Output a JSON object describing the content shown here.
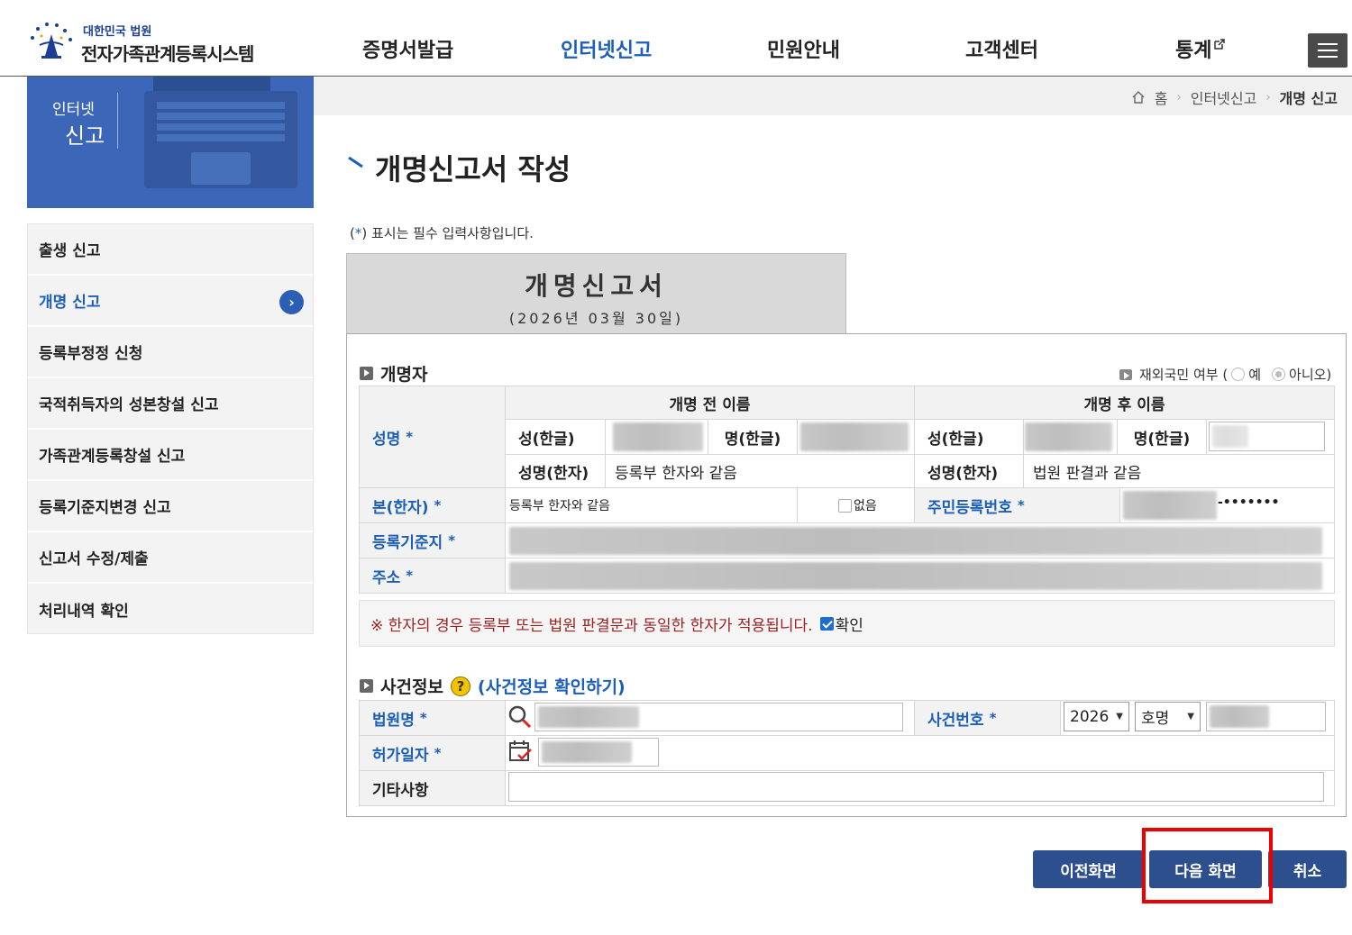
{
  "header": {
    "logo_sub": "대한민국 법원",
    "logo_main": "전자가족관계등록시스템",
    "nav": [
      {
        "label": "증명서발급",
        "active": false
      },
      {
        "label": "인터넷신고",
        "active": true
      },
      {
        "label": "민원안내",
        "active": false
      },
      {
        "label": "고객센터",
        "active": false
      },
      {
        "label": "통계",
        "active": false
      }
    ],
    "menu_icon": "hamburger-icon"
  },
  "banner": {
    "line1": "인터넷",
    "line2": "신고"
  },
  "sidebar": {
    "items": [
      {
        "label": "출생 신고",
        "active": false
      },
      {
        "label": "개명 신고",
        "active": true
      },
      {
        "label": "등록부정정 신청",
        "active": false
      },
      {
        "label": "국적취득자의 성본창설 신고",
        "active": false
      },
      {
        "label": "가족관계등록창설 신고",
        "active": false
      },
      {
        "label": "등록기준지변경 신고",
        "active": false
      },
      {
        "label": "신고서 수정/제출",
        "active": false
      },
      {
        "label": "처리내역 확인",
        "active": false
      }
    ]
  },
  "breadcrumb": {
    "home": "홈",
    "level1": "인터넷신고",
    "current": "개명 신고"
  },
  "page": {
    "title": "개명신고서 작성",
    "required_note_prefix": "(",
    "required_star": "*",
    "required_note_suffix": ") 표시는 필수 입력사항입니다."
  },
  "form_head": {
    "title": "개명신고서",
    "date": "(2026년 03월 30일)"
  },
  "section1": {
    "title": "개명자",
    "overseas_label": "재외국민 여부 (",
    "overseas_yes": "예",
    "overseas_no": "아니오)",
    "name_label": "성명",
    "before_header": "개명 전 이름",
    "after_header": "개명 후 이름",
    "surname_kr": "성(한글)",
    "given_kr": "명(한글)",
    "name_hanja": "성명(한자)",
    "before_hanja_value": "등록부 한자와 같음",
    "after_hanja_value": "법원 판결과 같음",
    "bon_label": "본(한자)",
    "bon_value": "등록부 한자와 같음",
    "none_label": "없음",
    "rrn_label": "주민등록번호",
    "rrn_mask": "-•••••••",
    "register_base_label": "등록기준지",
    "address_label": "주소"
  },
  "notice": {
    "text": "※ 한자의 경우 등록부 또는 법원 판결문과 동일한 한자가 적용됩니다.",
    "confirm_label": "확인",
    "confirmed": true
  },
  "section2": {
    "title": "사건정보",
    "help_link": "(사건정보 확인하기)",
    "court_label": "법원명",
    "case_no_label": "사건번호",
    "year_value": "2026",
    "case_type_value": "호명",
    "permit_date_label": "허가일자",
    "other_label": "기타사항"
  },
  "buttons": {
    "prev": "이전화면",
    "next": "다음 화면",
    "cancel": "취소"
  },
  "colors": {
    "accent": "#1c5fb8",
    "button": "#2d4f8e",
    "highlight": "#ee0000"
  }
}
